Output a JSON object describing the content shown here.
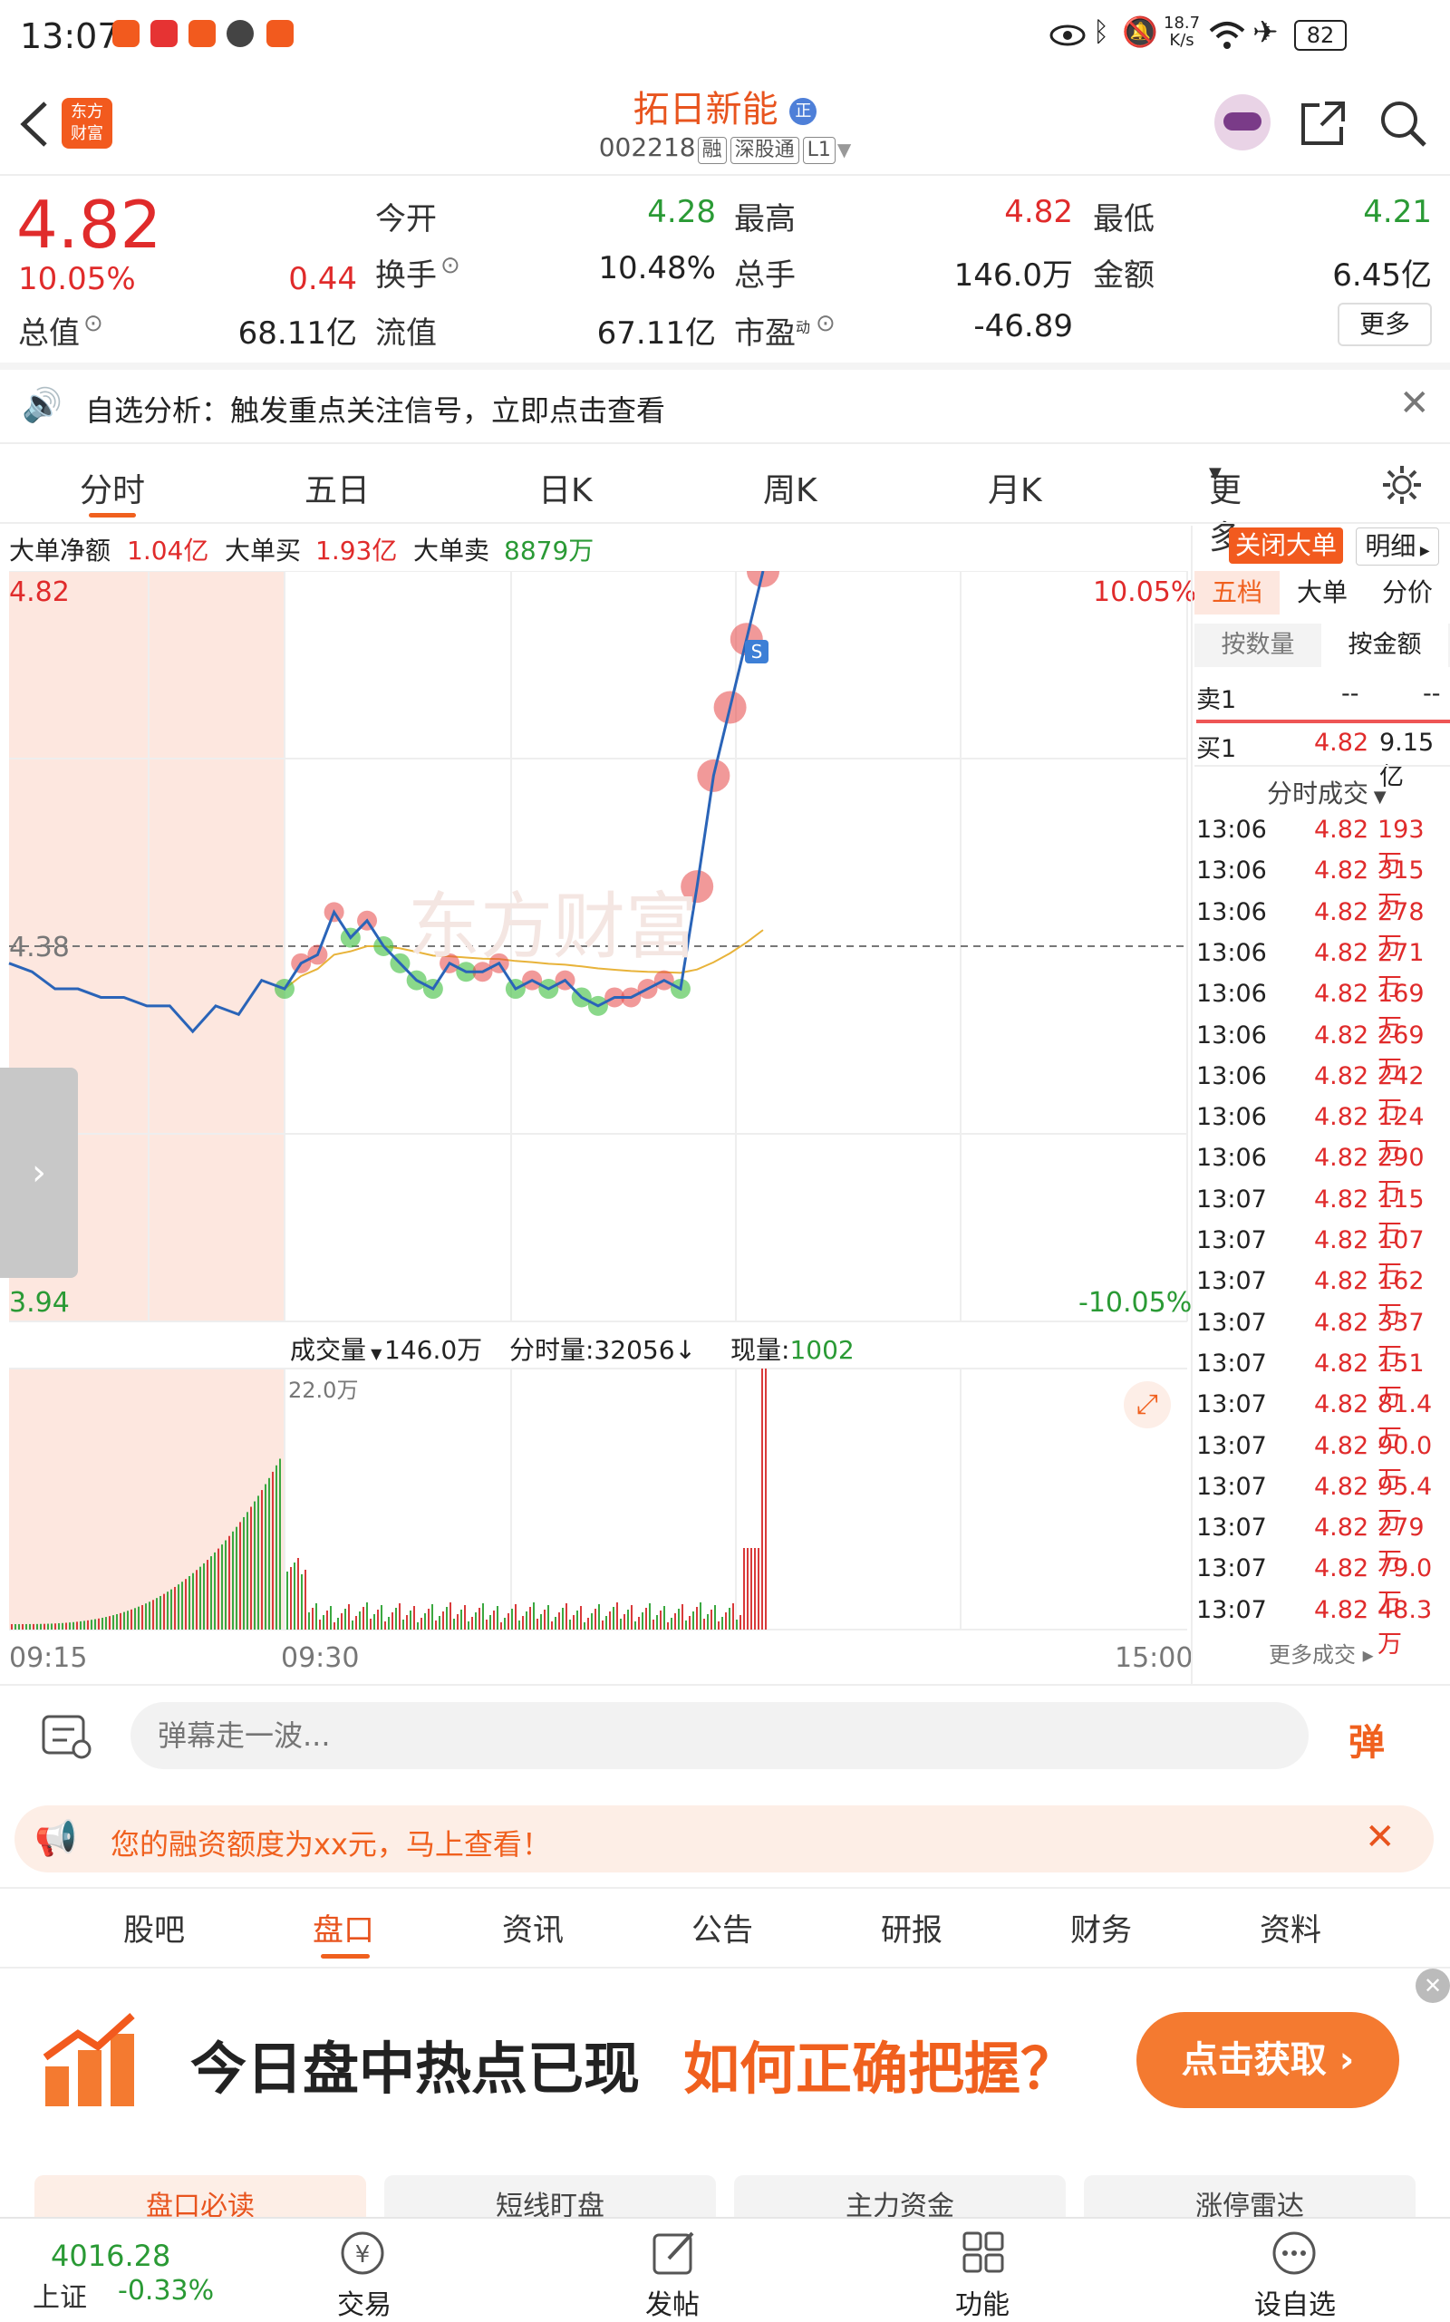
{
  "status_bar": {
    "time": "13:07",
    "net_speed": "18.7\nK/s",
    "net_speed_top": "18.7",
    "net_speed_bottom": "K/s",
    "battery": "82"
  },
  "header": {
    "logo_text_top": "东方",
    "logo_text_bottom": "财富",
    "title": "拓日新能",
    "title_badge": "正",
    "code": "002218",
    "tags": [
      "融",
      "深股通",
      "L1"
    ]
  },
  "quote": {
    "price": "4.82",
    "change_pct": "10.05%",
    "change_amt": "0.44",
    "labels": {
      "open": "今开",
      "high": "最高",
      "low": "最低",
      "turnover": "换手",
      "volume": "总手",
      "amount": "金额",
      "market_cap": "总值",
      "float_cap": "流值",
      "pe": "市盈",
      "pe_sup": "动",
      "more": "更多"
    },
    "open": "4.28",
    "high": "4.82",
    "low": "4.21",
    "turnover": "10.48%",
    "volume": "146.0万",
    "amount": "6.45亿",
    "market_cap": "68.11亿",
    "float_cap": "67.11亿",
    "pe": "-46.89"
  },
  "notice": {
    "text": "自选分析：触发重点关注信号，立即点击查看"
  },
  "chart_tabs": [
    "分时",
    "五日",
    "日K",
    "周K",
    "月K",
    "更多"
  ],
  "big_order": {
    "net_label": "大单净额",
    "net": "1.04亿",
    "buy_label": "大单买",
    "buy": "1.93亿",
    "sell_label": "大单卖",
    "sell": "8879万",
    "close_btn": "关闭大单",
    "detail_btn": "明细"
  },
  "intraday": {
    "y_top": "4.82",
    "y_mid": "4.38",
    "y_bottom": "3.94",
    "pct_top": "10.05%",
    "pct_bottom": "-10.05%",
    "watermark": "东方财富",
    "vol_label": "成交量",
    "vol_total": "146.0万",
    "vol_period": "分时量:32056",
    "vol_now_label": "现量:",
    "vol_now": "1002",
    "vol_max": "22.0万",
    "x_labels": [
      "09:15",
      "09:30",
      "15:00"
    ]
  },
  "chart_data": {
    "type": "line",
    "title": "",
    "x": [
      "09:15",
      "09:30",
      "15:00"
    ],
    "ylim": [
      3.94,
      4.82
    ],
    "pre_close": 4.38,
    "series": [
      {
        "name": "",
        "values": [
          4.36,
          4.35,
          4.33,
          4.33,
          4.32,
          4.32,
          4.31,
          4.31,
          4.28,
          4.31,
          4.3,
          4.34,
          4.33,
          4.36,
          4.37,
          4.42,
          4.39,
          4.41,
          4.38,
          4.36,
          4.34,
          4.33,
          4.36,
          4.35,
          4.35,
          4.36,
          4.33,
          4.34,
          4.33,
          4.34,
          4.32,
          4.31,
          4.32,
          4.32,
          4.33,
          4.34,
          4.33,
          4.45,
          4.58,
          4.66,
          4.74,
          4.82
        ]
      }
    ]
  },
  "order_book": {
    "tabs": [
      "五档",
      "大单",
      "分价"
    ],
    "mode_tabs": [
      "按数量",
      "按金额"
    ],
    "sell1": {
      "label": "卖1",
      "price": "--",
      "amount": "--"
    },
    "buy1": {
      "label": "买1",
      "price": "4.82",
      "amount": "9.15亿"
    },
    "trades_title": "分时成交",
    "trades": [
      [
        "13:06",
        "4.82",
        "193万"
      ],
      [
        "13:06",
        "4.82",
        "315万"
      ],
      [
        "13:06",
        "4.82",
        "278万"
      ],
      [
        "13:06",
        "4.82",
        "271万"
      ],
      [
        "13:06",
        "4.82",
        "169万"
      ],
      [
        "13:06",
        "4.82",
        "269万"
      ],
      [
        "13:06",
        "4.82",
        "242万"
      ],
      [
        "13:06",
        "4.82",
        "124万"
      ],
      [
        "13:06",
        "4.82",
        "290万"
      ],
      [
        "13:07",
        "4.82",
        "115万"
      ],
      [
        "13:07",
        "4.82",
        "107万"
      ],
      [
        "13:07",
        "4.82",
        "162万"
      ],
      [
        "13:07",
        "4.82",
        "337万"
      ],
      [
        "13:07",
        "4.82",
        "151万"
      ],
      [
        "13:07",
        "4.82",
        "81.4万"
      ],
      [
        "13:07",
        "4.82",
        "90.0万"
      ],
      [
        "13:07",
        "4.82",
        "95.4万"
      ],
      [
        "13:07",
        "4.82",
        "279万"
      ],
      [
        "13:07",
        "4.82",
        "79.0万"
      ],
      [
        "13:07",
        "4.82",
        "48.3万"
      ]
    ],
    "more_trades": "更多成交"
  },
  "comment": {
    "placeholder": "弹幕走一波...",
    "send": "弹"
  },
  "finance_banner": {
    "text": "您的融资额度为xx元，马上查看！"
  },
  "section_tabs": [
    "股吧",
    "盘口",
    "资讯",
    "公告",
    "研报",
    "财务",
    "资料"
  ],
  "ad": {
    "text_black": "今日盘中热点已现",
    "text_orange": "如何正确把握？",
    "button": "点击获取"
  },
  "sub_tabs": [
    "盘口必读",
    "短线盯盘",
    "主力资金",
    "涨停雷达"
  ],
  "bottom_bar": {
    "index_value": "4016.28",
    "index_name": "上证",
    "index_change": "-0.33%",
    "items": [
      "交易",
      "发帖",
      "功能",
      "设自选"
    ]
  }
}
